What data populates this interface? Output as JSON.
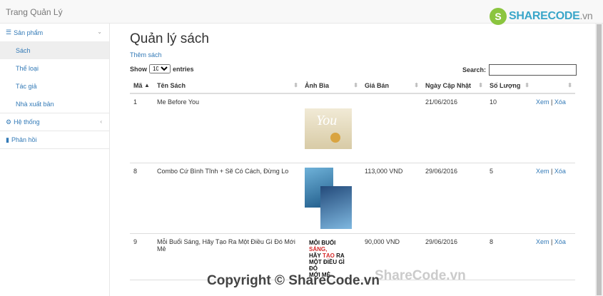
{
  "app": {
    "brand": "Trang Quản Lý",
    "logo_text": "SHARECODE",
    "logo_suffix": ".vn",
    "logo_letter": "S"
  },
  "sidebar": {
    "group1": {
      "label": "Sản phẩm",
      "items": [
        "Sách",
        "Thể loại",
        "Tác giả",
        "Nhà xuất bản"
      ]
    },
    "system": "Hệ thống",
    "feedback": "Phản hồi"
  },
  "main": {
    "title": "Quản lý sách",
    "add_link": "Thêm sách",
    "show": "Show",
    "entries": "entries",
    "page_size": "10",
    "search_label": "Search:"
  },
  "table": {
    "headers": [
      "Mã",
      "Tên Sách",
      "Ảnh Bìa",
      "Giá Bán",
      "Ngày Cập Nhật",
      "Số Lượng",
      ""
    ],
    "rows": [
      {
        "ma": "1",
        "ten": "Me Before You",
        "gia": "",
        "ngay": "21/06/2016",
        "sl": "10"
      },
      {
        "ma": "8",
        "ten": "Combo Cứ Bình Tĩnh + Sẽ Có Cách, Đừng Lo",
        "gia": "113,000 VND",
        "ngay": "29/06/2016",
        "sl": "5"
      },
      {
        "ma": "9",
        "ten": "Mỗi Buổi Sáng, Hãy Tạo Ra Một Điều Gì Đó Mới Mẻ",
        "gia": "90,000 VND",
        "ngay": "29/06/2016",
        "sl": "8"
      }
    ],
    "action_view": "Xem",
    "action_sep": "|",
    "action_delete": "Xóa",
    "cover1_text": "You",
    "cover3_line1": "MỖI BUỔI ",
    "cover3_red1": "SÁNG,",
    "cover3_line2": "HÃY ",
    "cover3_red2": "TẠO",
    "cover3_line2b": " RA",
    "cover3_line3": "MỘT ĐIỀU GÌ ĐÓ",
    "cover3_line4": "MỚI MẺ."
  },
  "watermarks": {
    "top": "ShareCode.vn",
    "bottom": "Copyright © ShareCode.vn"
  }
}
